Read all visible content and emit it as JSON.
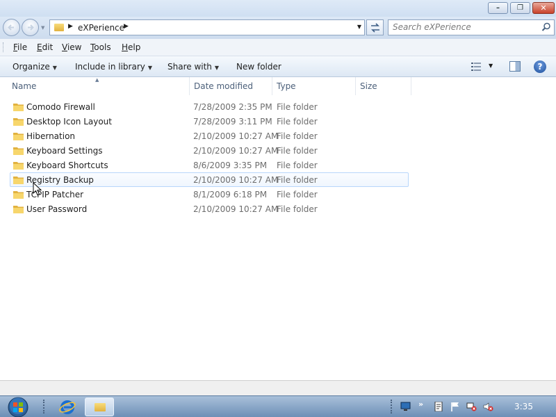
{
  "titlebar": {
    "minimize": "–",
    "maximize": "❐",
    "close": "✕"
  },
  "address": {
    "crumb": "eXPerience",
    "refresh_glyph": "↹",
    "search_placeholder": "Search eXPerience"
  },
  "menu": {
    "items": [
      {
        "key": "F",
        "rest": "ile"
      },
      {
        "key": "E",
        "rest": "dit"
      },
      {
        "key": "V",
        "rest": "iew"
      },
      {
        "key": "T",
        "rest": "ools"
      },
      {
        "key": "H",
        "rest": "elp"
      }
    ]
  },
  "commands": {
    "organize": "Organize",
    "include_in_library": "Include in library",
    "share_with": "Share with",
    "new_folder": "New folder",
    "help": "?"
  },
  "columns": {
    "name": "Name",
    "date": "Date modified",
    "type": "Type",
    "size": "Size"
  },
  "files": [
    {
      "name": "Comodo Firewall",
      "date": "7/28/2009 2:35 PM",
      "type": "File folder"
    },
    {
      "name": "Desktop Icon Layout",
      "date": "7/28/2009 3:11 PM",
      "type": "File folder"
    },
    {
      "name": "Hibernation",
      "date": "2/10/2009 10:27 AM",
      "type": "File folder"
    },
    {
      "name": "Keyboard Settings",
      "date": "2/10/2009 10:27 AM",
      "type": "File folder"
    },
    {
      "name": "Keyboard Shortcuts",
      "date": "8/6/2009 3:35 PM",
      "type": "File folder"
    },
    {
      "name": "Registry Backup",
      "date": "2/10/2009 10:27 AM",
      "type": "File folder"
    },
    {
      "name": "TCPIP Patcher",
      "date": "8/1/2009 6:18 PM",
      "type": "File folder"
    },
    {
      "name": "User Password",
      "date": "2/10/2009 10:27 AM",
      "type": "File folder"
    }
  ],
  "hovered_file": "Registry Backup",
  "taskbar": {
    "clock": "3:35",
    "tray_chevron": "»"
  },
  "colors": {
    "hover_border": "#b8d6fb",
    "folder_yellow": "#e2b23f",
    "taskbar_blue": "#6d8fb6"
  }
}
